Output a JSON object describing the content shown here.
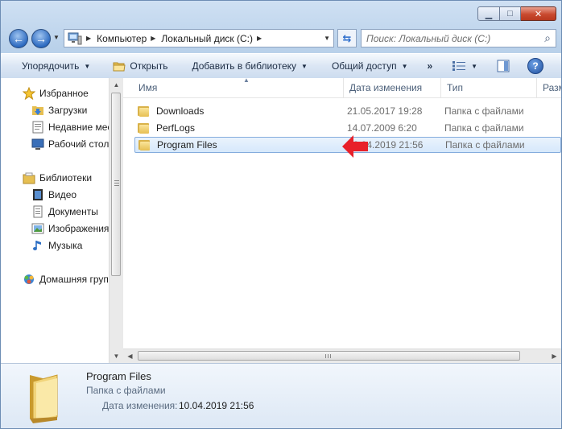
{
  "titlebar": {
    "minimize_glyph": "▁",
    "maximize_glyph": "□",
    "close_glyph": "✕"
  },
  "nav": {
    "back_glyph": "←",
    "forward_glyph": "→",
    "breadcrumb": [
      "Компьютер",
      "Локальный диск (C:)"
    ],
    "search_placeholder": "Поиск: Локальный диск (C:)"
  },
  "commandbar": {
    "organize": "Упорядочить",
    "open": "Открыть",
    "add_to_library": "Добавить в библиотеку",
    "share": "Общий доступ",
    "more": "»"
  },
  "sidebar": {
    "favorites_header": "Избранное",
    "favorites": [
      "Загрузки",
      "Недавние места",
      "Рабочий стол"
    ],
    "libraries_header": "Библиотеки",
    "libraries": [
      "Видео",
      "Документы",
      "Изображения",
      "Музыка"
    ],
    "homegroup": "Домашняя группа"
  },
  "columns": {
    "name": "Имя",
    "date": "Дата изменения",
    "type": "Тип",
    "size": "Размер"
  },
  "files": [
    {
      "name": "Downloads",
      "date": "21.05.2017 19:28",
      "type": "Папка с файлами"
    },
    {
      "name": "PerfLogs",
      "date": "14.07.2009 6:20",
      "type": "Папка с файлами"
    },
    {
      "name": "Program Files",
      "date": "10.04.2019 21:56",
      "type": "Папка с файлами"
    }
  ],
  "selected_index": 2,
  "details": {
    "name": "Program Files",
    "type": "Папка с файлами",
    "date_label": "Дата изменения:",
    "date_value": "10.04.2019 21:56"
  },
  "colors": {
    "annotation_arrow": "#e8202a",
    "selection_border": "#84acdd"
  }
}
